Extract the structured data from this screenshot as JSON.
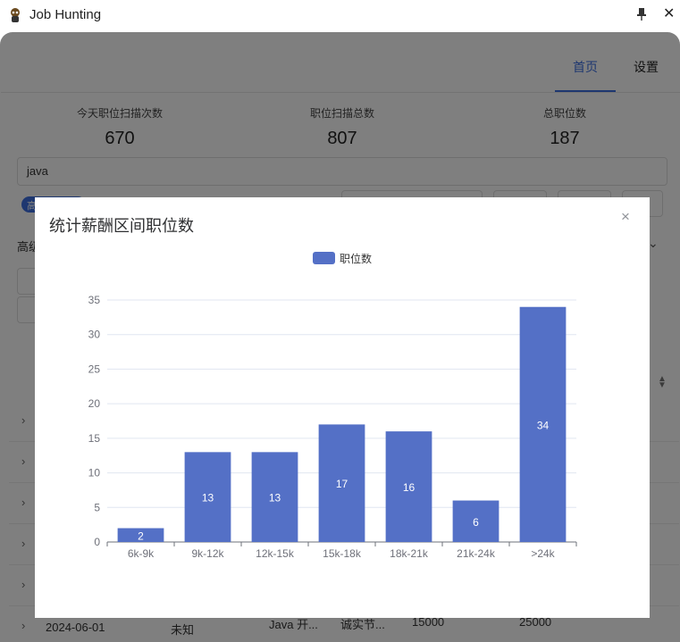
{
  "window": {
    "title": "Job Hunting"
  },
  "tabs": [
    {
      "label": "首页"
    },
    {
      "label": "设置"
    }
  ],
  "stats": [
    {
      "label": "今天职位扫描次数",
      "value": "670"
    },
    {
      "label": "职位扫描总数",
      "value": "807"
    },
    {
      "label": "总职位数",
      "value": "187"
    }
  ],
  "search": {
    "value": "java"
  },
  "background": {
    "tag_label": "高",
    "advanced_label": "高级",
    "row_partial": {
      "date": "2024-06-01",
      "c1": "未知",
      "c2": "Java 开...",
      "c3": "诚实节...",
      "c4": "15000",
      "c5": "25000"
    }
  },
  "dialog": {
    "title": "统计薪酬区间职位数",
    "close_symbol": "×"
  },
  "colors": {
    "accent": "#3d6fe0",
    "bar": "#5470c6"
  },
  "chart_data": {
    "type": "bar",
    "categories": [
      "6k-9k",
      "9k-12k",
      "12k-15k",
      "15k-18k",
      "18k-21k",
      "21k-24k",
      ">24k"
    ],
    "series": [
      {
        "name": "职位数",
        "values": [
          2,
          13,
          13,
          17,
          16,
          6,
          34
        ]
      }
    ],
    "yticks": [
      "0",
      "5",
      "10",
      "15",
      "20",
      "25",
      "30",
      "35"
    ],
    "ylim": [
      0,
      35
    ],
    "legend": "top-center",
    "grid": true
  }
}
